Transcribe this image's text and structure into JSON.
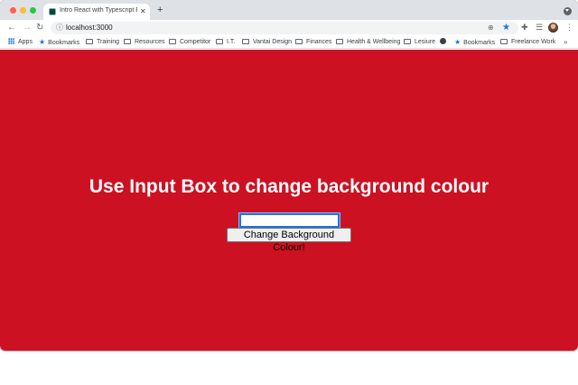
{
  "browser": {
    "tab_title": "Intro React with Typescript Exa",
    "url": "localhost:3000"
  },
  "bookmarks": [
    {
      "label": "Apps",
      "icon": "apps-grid-icon"
    },
    {
      "label": "Bookmarks",
      "icon": "star-icon"
    },
    {
      "label": "Training",
      "icon": "folder-icon"
    },
    {
      "label": "Resources",
      "icon": "folder-icon"
    },
    {
      "label": "Competitor",
      "icon": "folder-icon"
    },
    {
      "label": "I.T.",
      "icon": "folder-icon"
    },
    {
      "label": "Vantai Design",
      "icon": "folder-icon"
    },
    {
      "label": "Finances",
      "icon": "folder-icon"
    },
    {
      "label": "Health & Wellbeing",
      "icon": "folder-icon"
    },
    {
      "label": "Lesiure",
      "icon": "folder-icon"
    },
    {
      "label": "Bookmarks",
      "icon": "star-icon"
    },
    {
      "label": "Freelance Work",
      "icon": "folder-icon"
    }
  ],
  "page": {
    "background_color": "#cc1122",
    "heading": "Use Input Box to change background colour",
    "input_value": "",
    "button_label": "Change Background Colour!"
  }
}
